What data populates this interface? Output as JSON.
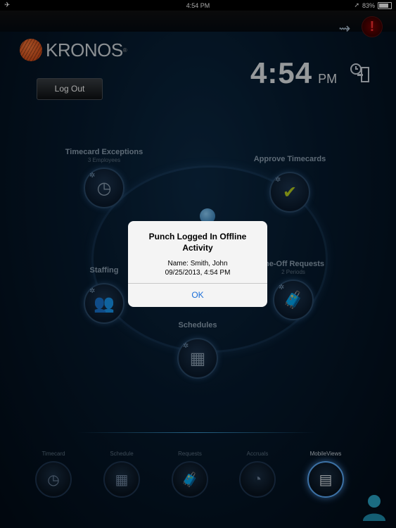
{
  "status_bar": {
    "time": "4:54 PM",
    "battery": "83%",
    "battery_level": 0.83,
    "airplane_glyph": "✈",
    "location_glyph": "➚"
  },
  "brand": {
    "name": "KRONOS",
    "trademark": "®"
  },
  "header": {
    "logout_label": "Log Out",
    "time": "4:54",
    "ampm": "PM",
    "alert_glyph": "!",
    "sync_glyph": "⇝"
  },
  "widgets": {
    "timecard_exceptions": {
      "title": "Timecard Exceptions",
      "subtitle": "3 Employees",
      "glyph": "◷"
    },
    "approve_timecards": {
      "title": "Approve Timecards",
      "glyph": "✔"
    },
    "staffing": {
      "title": "Staffing",
      "glyph": "👥"
    },
    "time_off_requests": {
      "title": "me-Off Requests",
      "subtitle": "2 Periods",
      "glyph": "🧳"
    },
    "schedules": {
      "title": "Schedules",
      "glyph": "▦"
    }
  },
  "dialog": {
    "title": "Punch Logged In Offline Activity",
    "name_line": "Name: Smith, John",
    "datetime_line": "09/25/2013, 4:54 PM",
    "ok_label": "OK"
  },
  "tabs": [
    {
      "label": "Timecard",
      "glyph": "◷"
    },
    {
      "label": "Schedule",
      "glyph": "▦"
    },
    {
      "label": "Requests",
      "glyph": "🧳"
    },
    {
      "label": "Accruals",
      "glyph": "◔"
    },
    {
      "label": "MobileViews",
      "glyph": "▤"
    }
  ],
  "colors": {
    "accent": "#1a6ed8",
    "brand": "#e05a1c",
    "background": "#061a2e"
  }
}
